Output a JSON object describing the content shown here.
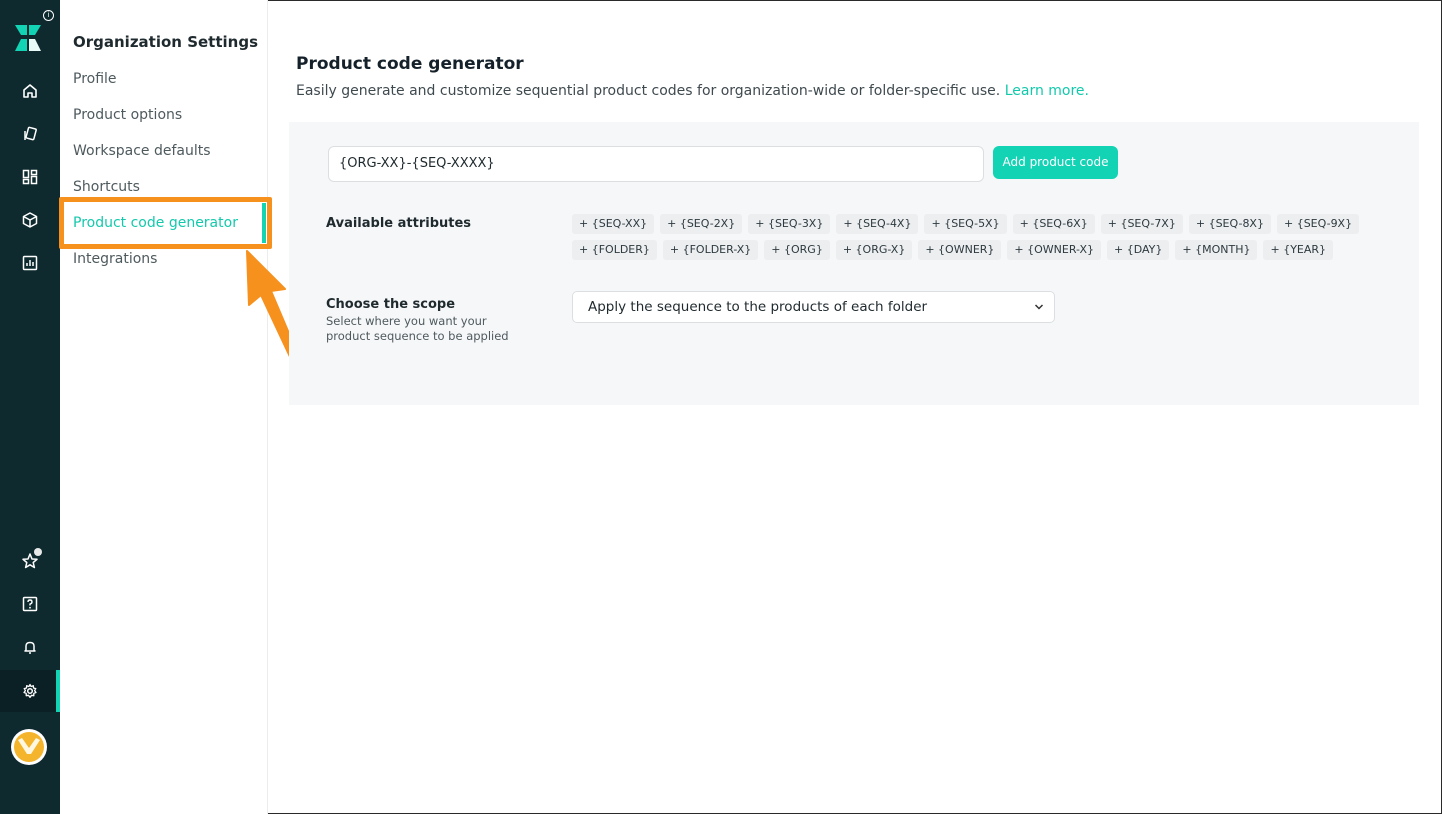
{
  "sidebar": {
    "title": "Organization Settings",
    "items": [
      {
        "label": "Profile"
      },
      {
        "label": "Product options"
      },
      {
        "label": "Workspace defaults"
      },
      {
        "label": "Shortcuts"
      },
      {
        "label": "Product code generator",
        "active": true
      },
      {
        "label": "Integrations"
      }
    ]
  },
  "rail": {
    "icons": [
      "home-icon",
      "catalog-icon",
      "dashboard-icon",
      "box-icon",
      "analytics-icon",
      "star-icon",
      "help-icon",
      "bell-icon",
      "gear-icon"
    ],
    "info_glyph": "i"
  },
  "main": {
    "title": "Product code generator",
    "description": "Easily generate and customize sequential product codes for organization-wide or folder-specific use.",
    "learn_more": "Learn more.",
    "code_input_value": "{ORG-XX}-{SEQ-XXXX}",
    "add_button": "Add product code",
    "attributes_label": "Available attributes",
    "attributes_row1": [
      "+ {SEQ-XX}",
      "+ {SEQ-2X}",
      "+ {SEQ-3X}",
      "+ {SEQ-4X}",
      "+ {SEQ-5X}",
      "+ {SEQ-6X}",
      "+ {SEQ-7X}",
      "+ {SEQ-8X}",
      "+ {SEQ-9X}"
    ],
    "attributes_row2": [
      "+ {FOLDER}",
      "+ {FOLDER-X}",
      "+ {ORG}",
      "+ {ORG-X}",
      "+ {OWNER}",
      "+ {OWNER-X}",
      "+ {DAY}",
      "+ {MONTH}",
      "+ {YEAR}"
    ],
    "scope_label": "Choose the scope",
    "scope_sub": "Select where you want your product sequence to be applied",
    "scope_value": "Apply the sequence to the products of each folder"
  },
  "colors": {
    "rail_bg": "#0f2a2f",
    "accent": "#13d3b5",
    "highlight": "#f7911e"
  }
}
